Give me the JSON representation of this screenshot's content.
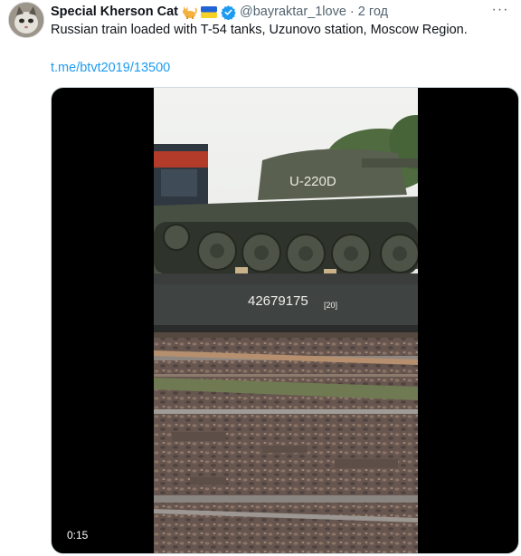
{
  "tweet": {
    "author_name": "Special Kherson Cat",
    "author_handle": "@bayraktar_1love",
    "separator": "·",
    "timestamp": "2 год",
    "more_label": "···",
    "text": "Russian train loaded with T-54 tanks, Uzunovo station, Moscow Region.",
    "link_text": "t.me/btvt2019/13500",
    "icons": [
      "cat-emoji-icon",
      "ukraine-flag-icon",
      "verified-badge-icon",
      "more-options-icon"
    ],
    "colors": {
      "link": "#1d9bf0",
      "secondary_text": "#536471",
      "verified": "#1d9bf0"
    }
  },
  "media": {
    "type": "video",
    "duration": "0:15",
    "frame_text": {
      "turret_marking": "U-220D",
      "wagon_number": "42679175",
      "wagon_code": "[20]"
    }
  }
}
